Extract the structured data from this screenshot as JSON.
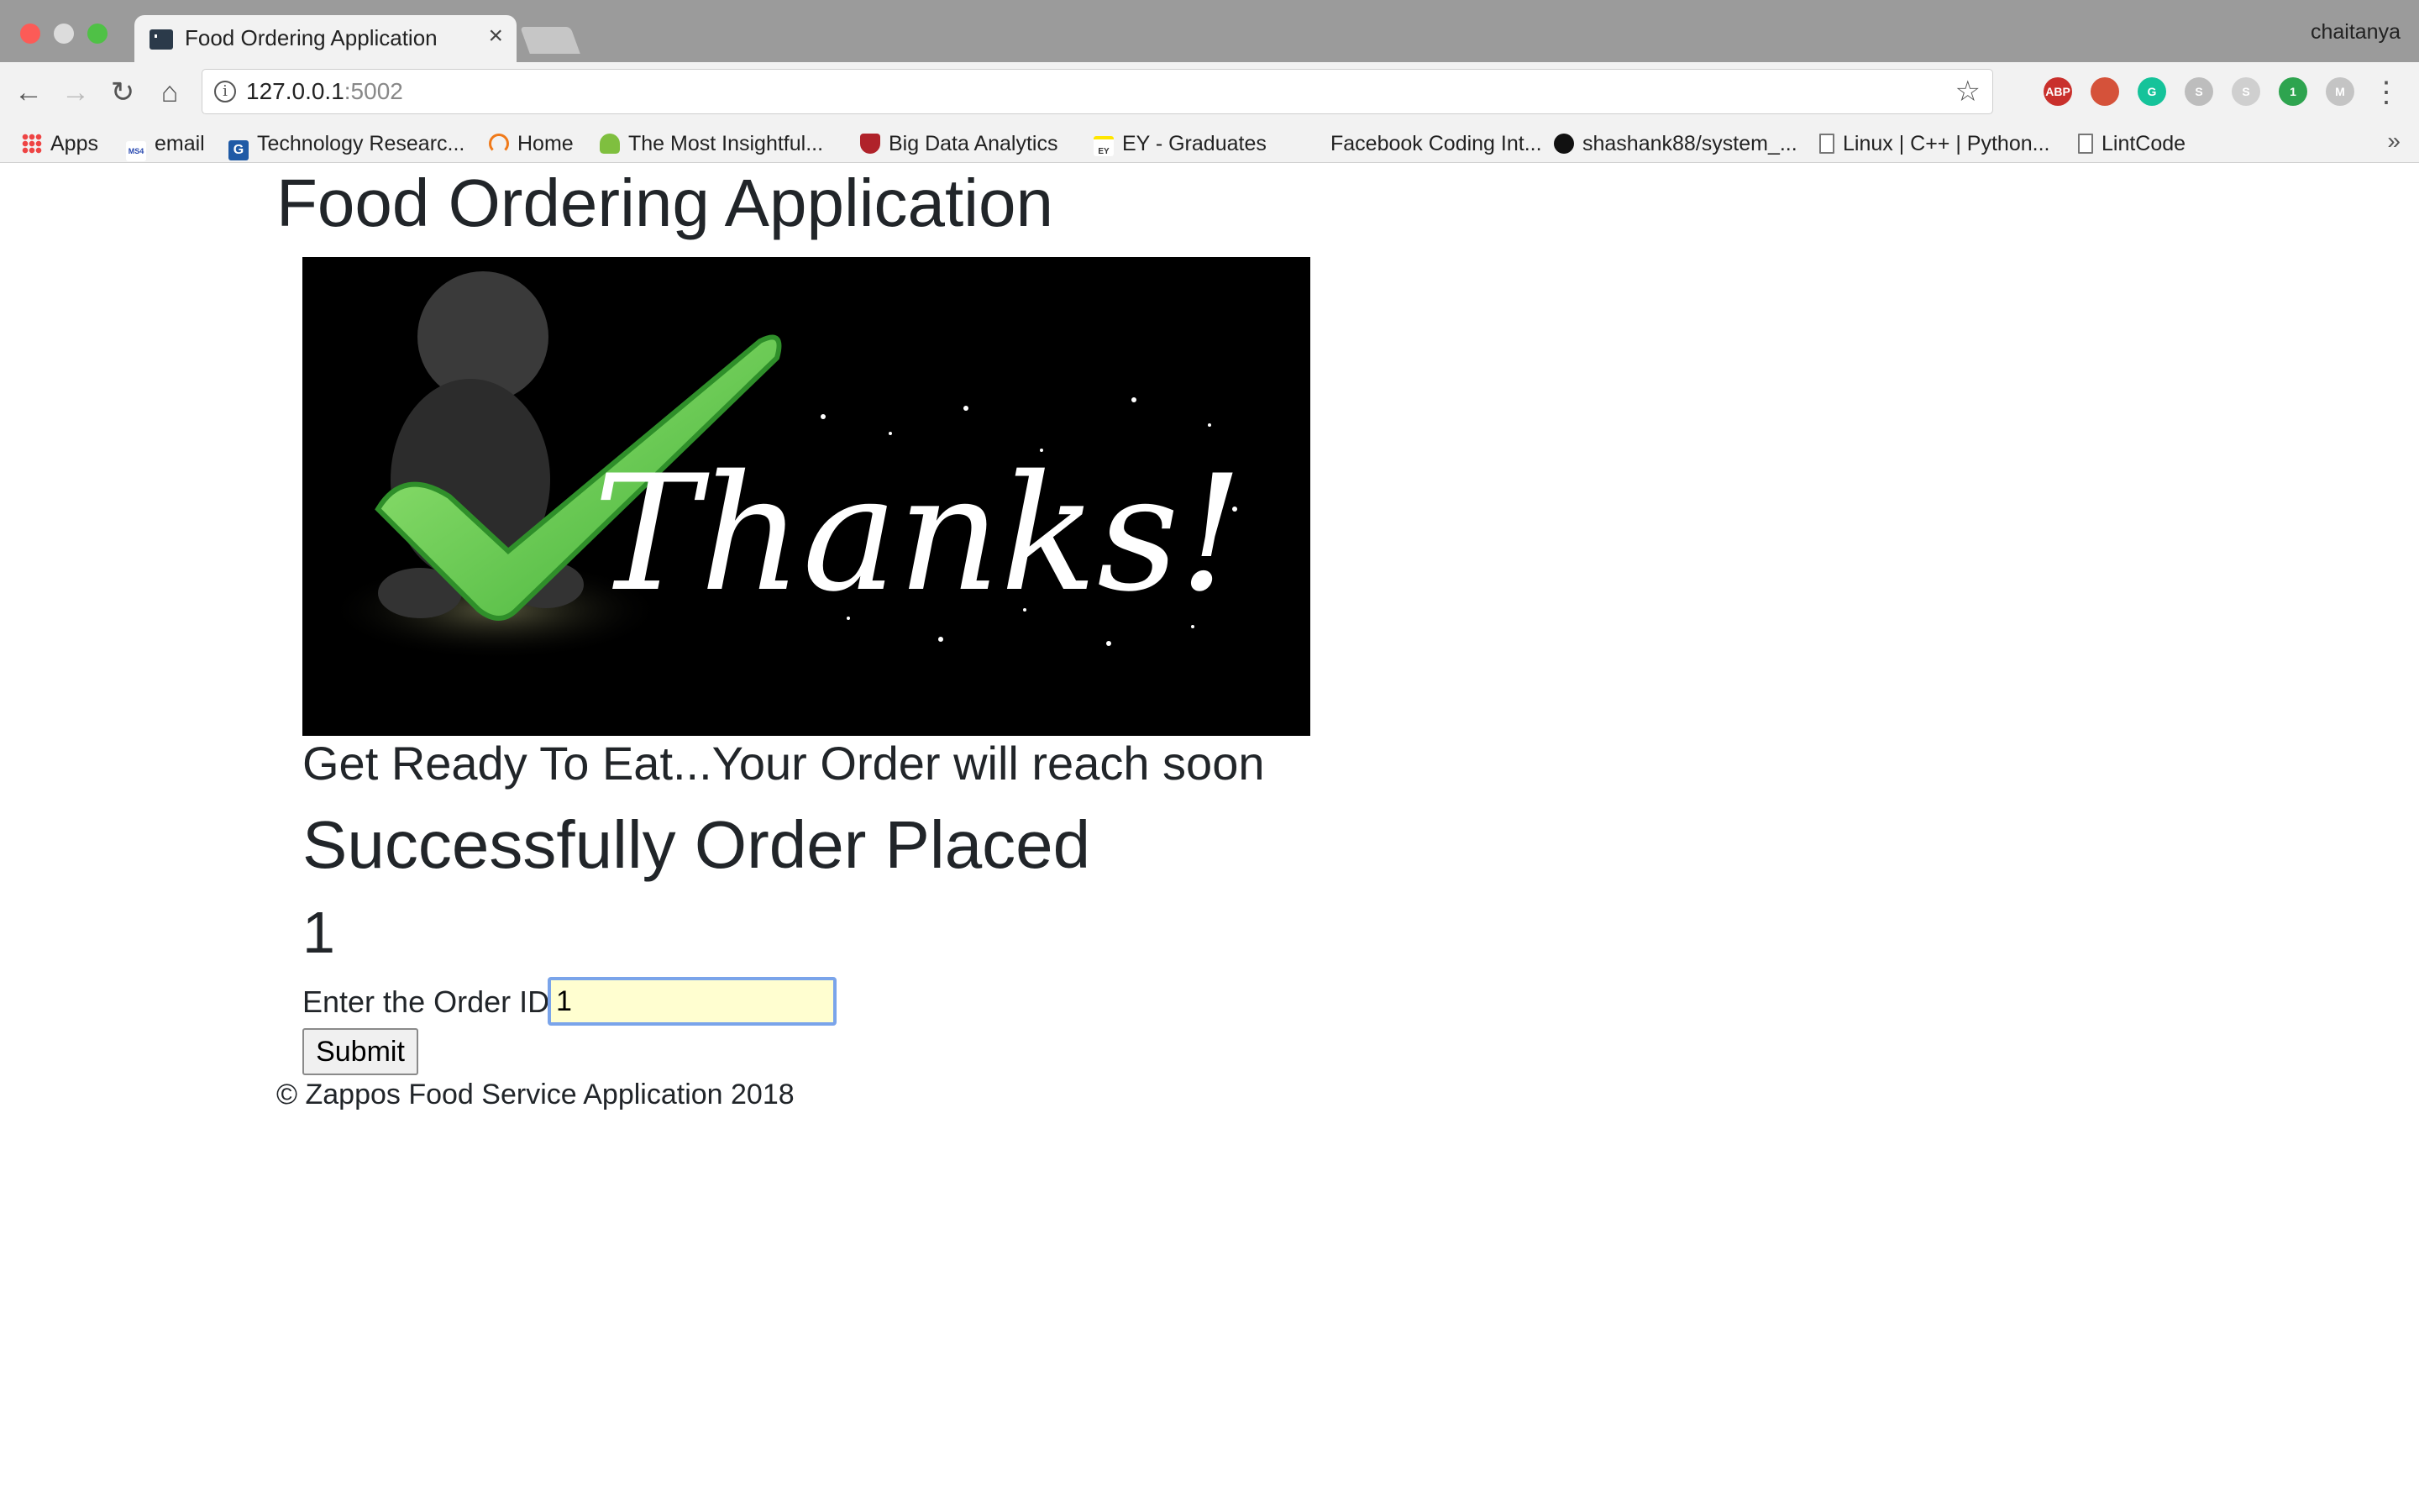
{
  "browser": {
    "tab_title": "Food Ordering Application",
    "tab_close": "×",
    "profile_name": "chaitanya",
    "url_host": "127.0.0.1",
    "url_port": ":5002",
    "nav": {
      "back": "←",
      "forward": "→",
      "reload": "↻",
      "home": "⌂"
    },
    "star": "☆",
    "menu": "⋮",
    "extensions": [
      {
        "name": "adblock-plus-icon",
        "label": "ABP",
        "color": "#c9302c"
      },
      {
        "name": "bookmark-extension-icon",
        "label": "",
        "color": "#d5523a"
      },
      {
        "name": "grammarly-icon",
        "label": "G",
        "color": "#15c39a"
      },
      {
        "name": "extension-s-icon",
        "label": "S",
        "color": "#bdbdbd"
      },
      {
        "name": "skype-icon",
        "label": "S",
        "color": "#cfcfcf"
      },
      {
        "name": "extension-badge-icon",
        "label": "1",
        "color": "#2ea44f"
      },
      {
        "name": "extension-m-icon",
        "label": "M",
        "color": "#c4c4c4"
      }
    ],
    "bookmarks": [
      {
        "label": "Apps",
        "icon": "apps-icon"
      },
      {
        "label": "email",
        "icon": "ms4-icon"
      },
      {
        "label": "Technology Researc...",
        "icon": "ga-icon"
      },
      {
        "label": "Home",
        "icon": "home-arc-icon"
      },
      {
        "label": "The Most Insightful...",
        "icon": "tree-icon"
      },
      {
        "label": "Big Data Analytics",
        "icon": "shield-icon"
      },
      {
        "label": "EY - Graduates",
        "icon": "ey-icon"
      },
      {
        "label": "Facebook Coding Int...",
        "icon": ""
      },
      {
        "label": "shashank88/system_...",
        "icon": "github-icon"
      },
      {
        "label": "Linux | C++ | Python...",
        "icon": "page-icon"
      },
      {
        "label": "LintCode",
        "icon": "page-icon"
      }
    ],
    "more_bookmarks": "»"
  },
  "page": {
    "title": "Food Ordering Application",
    "hero_text": "Thanks!",
    "tagline": "Get Ready To Eat...Your Order will reach soon",
    "status_heading": "Successfully Order Placed",
    "order_number": "1",
    "form": {
      "label": "Enter the Order ID:",
      "input_value": "1",
      "submit_label": "Submit"
    },
    "footer": "© Zappos Food Service Application 2018"
  }
}
